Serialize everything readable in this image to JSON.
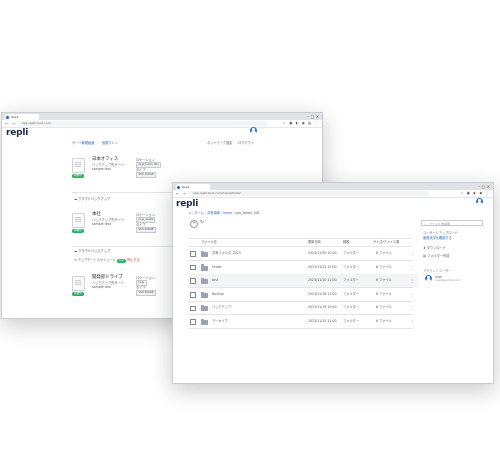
{
  "back_window": {
    "tab_label": "Repli",
    "url": "app.replicloud.com",
    "logo": "repli",
    "breadcrumb": [
      "サーバ管理画面",
      "仮想マシン"
    ],
    "right_links": [
      "ネットワーク設定",
      "ログアウト"
    ],
    "cards": [
      {
        "title": "日本オフィス",
        "subtitle": "バックアップ先サーバ",
        "status": "稼働中",
        "meta": "sample text",
        "location_label": "ロケーション",
        "location_value": "ja-jp_tokyo_001",
        "spec_label": "タイプ",
        "spec_value": "SSD 100GB"
      },
      {
        "title": "本社",
        "subtitle": "バックアップ先サーバ",
        "status": "稼働中",
        "meta": "sample text",
        "location_label": "ロケーション",
        "location_value": "ja-jp_osaka",
        "spec_label": "タイプ",
        "spec_value": "SSD 200GB"
      },
      {
        "title": "開発部ドライブ",
        "subtitle": "バックアップ先サーバ",
        "status": "稼働中",
        "meta": "sample text",
        "location_label": "ロケーション",
        "location_value": "ja-jp",
        "spec_label": "タイプ",
        "spec_value": "SSD 500GB"
      }
    ],
    "sections": [
      "クラウドバックアップ",
      "クラウドバックアップ"
    ],
    "section_extra": {
      "label": "アップデートスケジュール",
      "badge": "有効",
      "link": "停止する"
    }
  },
  "front_window": {
    "tab_label": "Repli",
    "url": "app.replicloud.com/home/folder",
    "logo": "repli",
    "breadcrumb": [
      "ホーム",
      "共有領域",
      "home",
      "sub_folder_001"
    ],
    "columns": {
      "name": "ファイル名",
      "date": "更新日時",
      "type": "種類",
      "size": "サイズ/ファイル数"
    },
    "rows": [
      {
        "name": "共有フォルダ_2023",
        "date": "2023/11/30 10:00",
        "type": "フォルダー",
        "size": "8 ファイル"
      },
      {
        "name": "Finder",
        "date": "2023/11/22 15:00",
        "type": "フォルダー",
        "size": "8 ファイル"
      },
      {
        "name": "test",
        "date": "2023/11/20 11:00",
        "type": "フォルダー",
        "size": "6 ファイル"
      },
      {
        "name": "Backup",
        "date": "2023/11/18 11:00",
        "type": "フォルダー",
        "size": "8 ファイル"
      },
      {
        "name": "バックアップ",
        "date": "2023/11/16 10:00",
        "type": "フォルダー",
        "size": "8 ファイル"
      },
      {
        "name": "アーカイブ",
        "date": "2023/11/15 11:00",
        "type": "フォルダー",
        "size": "8 ファイル"
      }
    ],
    "side": {
      "search_placeholder": "ファイルを検索",
      "heading": "ユーザーとアップロード",
      "link": "使用状況を確認する",
      "items": [
        "ダウンロード",
        "フォルダー作成"
      ],
      "account_heading": "アカウントユーザー",
      "account_name": "User",
      "account_sub": "user@example.com"
    }
  }
}
